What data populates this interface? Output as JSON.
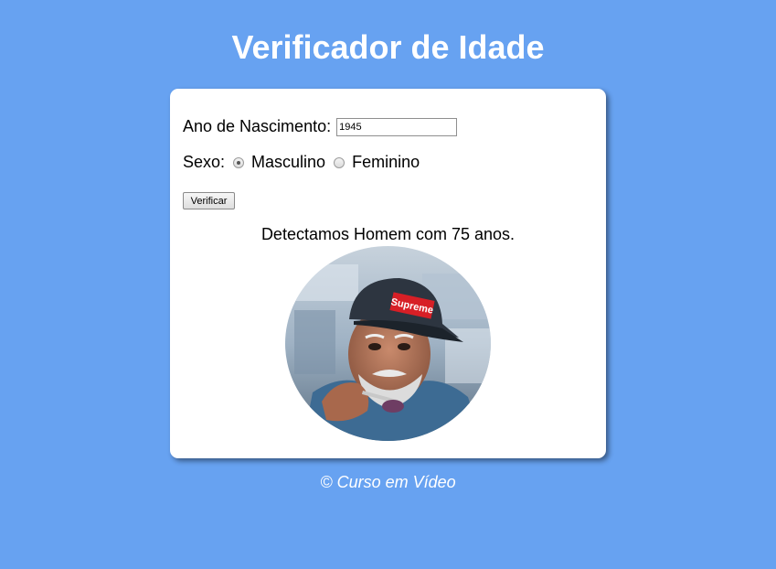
{
  "header": {
    "title": "Verificador de Idade"
  },
  "form": {
    "birth_label": "Ano de Nascimento:",
    "birth_value": "1945",
    "sex_label": "Sexo:",
    "sex_options": [
      "Masculino",
      "Feminino"
    ],
    "sex_selected": "Masculino",
    "verify_button": "Verificar"
  },
  "result": {
    "text": "Detectamos Homem com 75 anos.",
    "cap_logo_text": "Supreme"
  },
  "footer": {
    "text": "© Curso em Vídeo"
  },
  "colors": {
    "background": "#67a2f1",
    "card": "#ffffff",
    "title": "#ffffff"
  }
}
